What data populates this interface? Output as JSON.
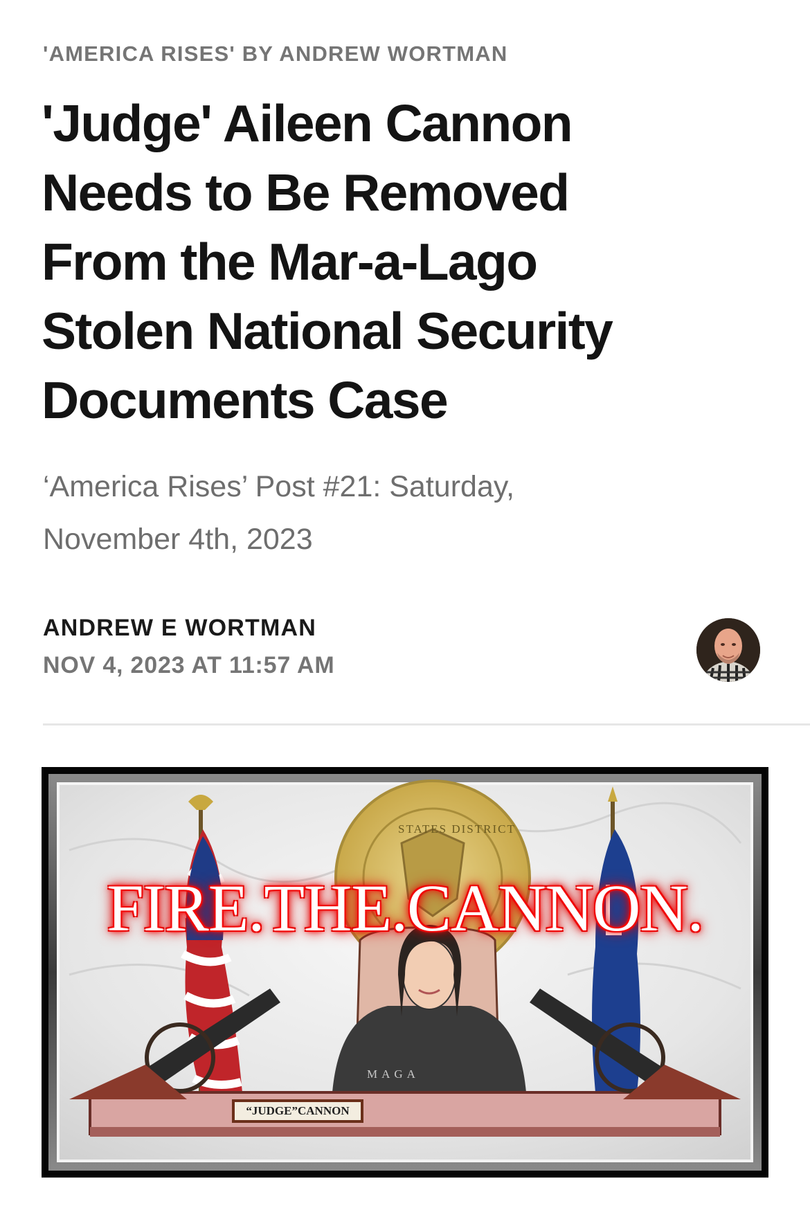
{
  "kicker": "'AMERICA RISES' BY ANDREW WORTMAN",
  "title_lines": [
    "'Judge' Aileen Cannon",
    "Needs to Be Removed",
    "From the Mar-a-Lago",
    "Stolen National Security",
    "Documents Case"
  ],
  "subtitle_lines": [
    "‘America Rises’ Post #21: Saturday,",
    "November 4th, 2023"
  ],
  "byline": {
    "author": "ANDREW E WORTMAN",
    "date": "NOV 4, 2023 AT 11:57 AM"
  },
  "hero": {
    "headline": "FIRE.THE.CANNON.",
    "seal_text": "STATES DISTRICT",
    "robe_text": "MAGA",
    "nameplate": "“JUDGE”CANNON"
  },
  "colors": {
    "headline_glow": "#e00000",
    "seal_gold": "#d9c06a",
    "flag_blue": "#1d3f8f"
  }
}
